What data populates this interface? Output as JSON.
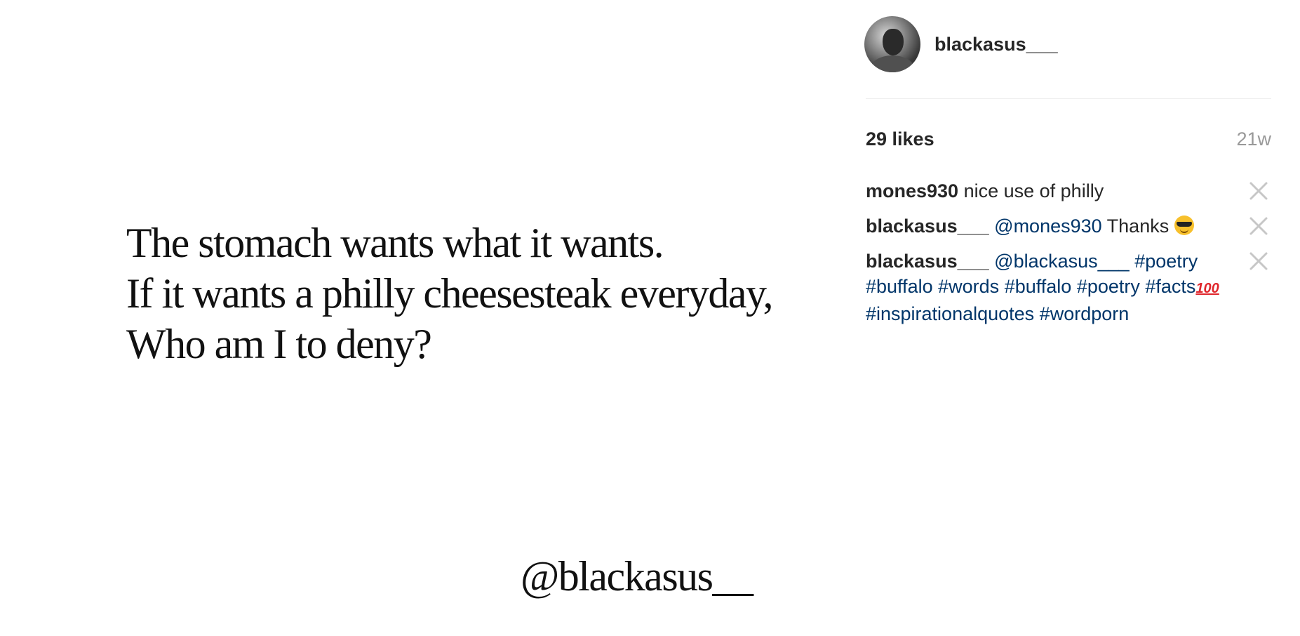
{
  "post": {
    "quote_lines": [
      "The stomach wants what it wants.",
      "If it wants a philly cheesesteak everyday,",
      "Who am I to deny?"
    ],
    "watermark": "@blackasus__"
  },
  "header": {
    "username": "blackasus___",
    "avatar_icon": "profile-photo"
  },
  "stats": {
    "likes": "29 likes",
    "time_ago": "21w"
  },
  "comments": [
    {
      "author": "mones930",
      "text": " nice use of philly"
    },
    {
      "author": "blackasus___",
      "mention": "@mones930",
      "text": " Thanks ",
      "emoji": "smiling-face-with-sunglasses"
    },
    {
      "author": "blackasus___",
      "mention": "@blackasus___",
      "hashtags": [
        "#poetry",
        "#buffalo",
        "#words",
        "#buffalo",
        "#poetry",
        "#facts"
      ],
      "emoji": "hundred-points",
      "emoji_text": "100",
      "hashtags2": [
        "#inspirationalquotes",
        "#wordporn"
      ]
    }
  ],
  "colors": {
    "link": "#003569",
    "muted": "#999999",
    "text": "#262626",
    "close_icon": "#c7c7c7"
  }
}
